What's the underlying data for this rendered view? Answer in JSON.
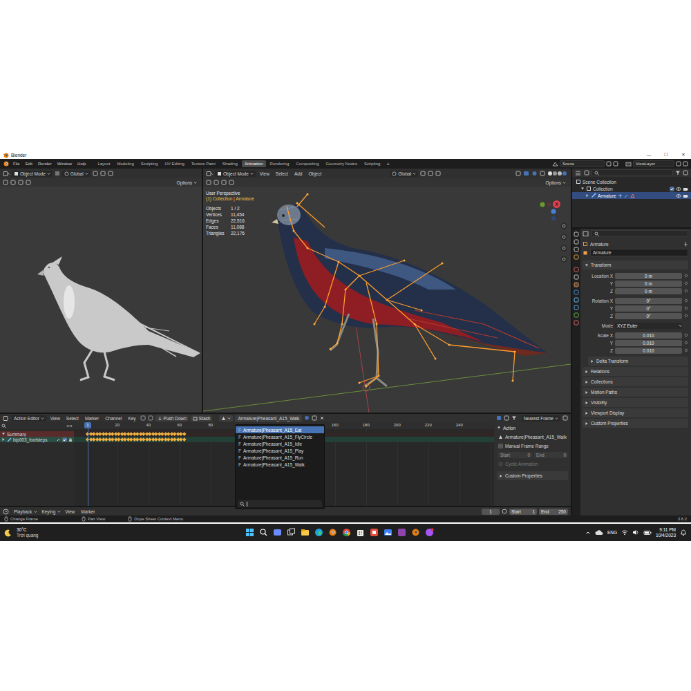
{
  "window": {
    "title": "Blender",
    "controls": [
      "—",
      "☐",
      "✕"
    ]
  },
  "topbar": {
    "menus": [
      "File",
      "Edit",
      "Render",
      "Window",
      "Help"
    ],
    "workspaces": [
      {
        "label": "Layout",
        "selected": false
      },
      {
        "label": "Modeling",
        "selected": false
      },
      {
        "label": "Sculpting",
        "selected": false
      },
      {
        "label": "UV Editing",
        "selected": false
      },
      {
        "label": "Texture Paint",
        "selected": false
      },
      {
        "label": "Shading",
        "selected": false
      },
      {
        "label": "Animation",
        "selected": true
      },
      {
        "label": "Rendering",
        "selected": false
      },
      {
        "label": "Compositing",
        "selected": false
      },
      {
        "label": "Geometry Nodes",
        "selected": false
      },
      {
        "label": "Scripting",
        "selected": false
      }
    ],
    "add_workspace": "+",
    "scene": "Scene",
    "view_layer": "ViewLayer"
  },
  "camera_view": {
    "mode": "Object Mode",
    "orientation": "Global",
    "options": "Options"
  },
  "viewport": {
    "mode": "Object Mode",
    "menus": [
      "View",
      "Select",
      "Add",
      "Object"
    ],
    "orientation": "Global",
    "options": "Options",
    "view_name": "User Perspective",
    "context": "(1) Collection | Armature",
    "stats": [
      {
        "label": "Objects",
        "value": "1 / 2"
      },
      {
        "label": "Vertices",
        "value": "11,454"
      },
      {
        "label": "Edges",
        "value": "22,516"
      },
      {
        "label": "Faces",
        "value": "11,088"
      },
      {
        "label": "Triangles",
        "value": "22,176"
      }
    ],
    "gizmo_label": "X"
  },
  "outliner": {
    "items": [
      {
        "label": "Scene Collection",
        "depth": 0,
        "selected": false
      },
      {
        "label": "Collection",
        "depth": 1,
        "selected": false
      },
      {
        "label": "Armature",
        "depth": 2,
        "selected": true
      }
    ]
  },
  "properties": {
    "object": "Armature",
    "name": "Armature",
    "panel": {
      "label": "Transform",
      "expanded": true
    },
    "groups": [
      [
        {
          "label": "Location X",
          "value": "0 m",
          "kind": "field"
        },
        {
          "label": "Y",
          "value": "0 m",
          "kind": "field"
        },
        {
          "label": "Z",
          "value": "0 m",
          "kind": "field"
        }
      ],
      [
        {
          "label": "Rotation X",
          "value": "0°",
          "kind": "field"
        },
        {
          "label": "Y",
          "value": "0°",
          "kind": "field"
        },
        {
          "label": "Z",
          "value": "0°",
          "kind": "field"
        }
      ],
      [
        {
          "label": "Mode",
          "value": "XYZ Euler",
          "kind": "dropdown"
        }
      ],
      [
        {
          "label": "Scale X",
          "value": "0.010",
          "kind": "field"
        },
        {
          "label": "Y",
          "value": "0.010",
          "kind": "field"
        },
        {
          "label": "Z",
          "value": "0.010",
          "kind": "field"
        }
      ]
    ],
    "subpanels": [
      {
        "label": "Delta Transform",
        "depth": 1,
        "expanded": false
      },
      {
        "label": "Relations",
        "depth": 0,
        "expanded": false
      },
      {
        "label": "Collections",
        "depth": 0,
        "expanded": false
      },
      {
        "label": "Motion Paths",
        "depth": 0,
        "expanded": false
      },
      {
        "label": "Visibility",
        "depth": 0,
        "expanded": false
      },
      {
        "label": "Viewport Display",
        "depth": 0,
        "expanded": false
      },
      {
        "label": "Custom Properties",
        "depth": 0,
        "expanded": false
      }
    ]
  },
  "action_editor": {
    "mode": "Action Editor",
    "menus": [
      "View",
      "Select",
      "Marker",
      "Channel",
      "Key"
    ],
    "push_down": "Push Down",
    "stash": "Stash",
    "action": "Armature|Pheasant_A15_Walk",
    "snapping": "Nearest Frame",
    "current_frame": "1",
    "ruler": [
      "20",
      "40",
      "60",
      "80",
      "160",
      "180",
      "200",
      "220",
      "240"
    ],
    "channels": [
      {
        "label": "Summary",
        "kind": "summary",
        "expanded": true
      },
      {
        "label": "bip003_footsteps",
        "kind": "object",
        "expanded": false
      }
    ],
    "keyframes": [
      1,
      3,
      5,
      7,
      9,
      11,
      13,
      15,
      17,
      19,
      21,
      23,
      25,
      27,
      29,
      31,
      33,
      35,
      37,
      39,
      41,
      43,
      45,
      47,
      49,
      51,
      53,
      55,
      57,
      59,
      61,
      63
    ]
  },
  "action_menu": {
    "items": [
      {
        "label": "Armature|Pheasant_A15_Eat",
        "fake_user": "F",
        "selected": true
      },
      {
        "label": "Armature|Pheasant_A15_FlyCircle",
        "fake_user": "F",
        "selected": false
      },
      {
        "label": "Armature|Pheasant_A15_Idle",
        "fake_user": "F",
        "selected": false
      },
      {
        "label": "Armature|Pheasant_A15_Play",
        "fake_user": "F",
        "selected": false
      },
      {
        "label": "Armature|Pheasant_A15_Run",
        "fake_user": "F",
        "selected": false
      },
      {
        "label": "Armature|Pheasant_A15_Walk",
        "fake_user": "F",
        "selected": false
      }
    ]
  },
  "side_panel": {
    "title": "Action",
    "action": "Armature|Pheasant_A15_Walk",
    "manual_range": {
      "label": "Manual Frame Range",
      "checked": false
    },
    "start": {
      "label": "Start",
      "value": "0",
      "disabled": true
    },
    "end": {
      "label": "End",
      "value": "0",
      "disabled": true
    },
    "cyclic": {
      "label": "Cyclic Animation",
      "checked": false,
      "disabled": true
    },
    "custom_properties": {
      "label": "Custom Properties",
      "expanded": false
    }
  },
  "timeline": {
    "menus": [
      "Playback",
      "Keying",
      "View",
      "Marker"
    ],
    "frame": "1",
    "start": {
      "label": "Start",
      "value": "1"
    },
    "end": {
      "label": "End",
      "value": "250"
    }
  },
  "status_bar": {
    "hints": [
      "Change Frame",
      "Pan View",
      "Dope Sheet Context Menu"
    ],
    "version": "3.6.2"
  },
  "taskbar": {
    "temperature": "30°C",
    "weather": "Trời quang",
    "language": "ENG",
    "time": "9:11 PM",
    "date": "10/4/2023"
  }
}
